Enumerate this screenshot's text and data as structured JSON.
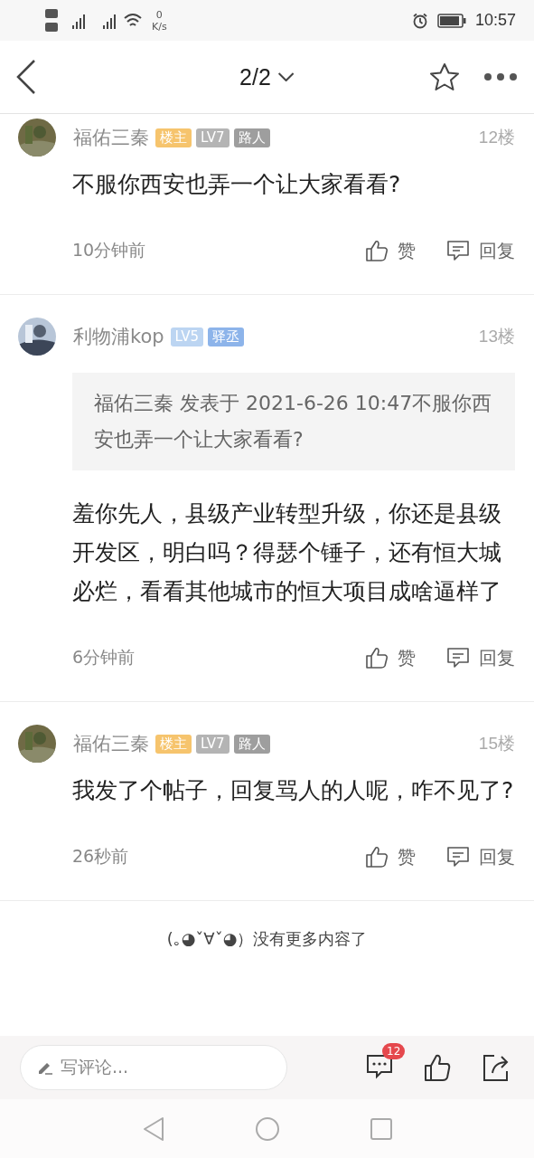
{
  "status_bar": {
    "speed_value": "0",
    "speed_unit": "K/s",
    "time": "10:57"
  },
  "header": {
    "page": "2/2"
  },
  "posts": [
    {
      "author": "福佑三秦",
      "badges": [
        {
          "text": "楼主",
          "color": "#f6c46d"
        },
        {
          "text": "LV7",
          "color": "#b4b4b4"
        },
        {
          "text": "路人",
          "color": "#9e9e9e"
        }
      ],
      "floor": "12楼",
      "body": "不服你西安也弄一个让大家看看?",
      "time": "10分钟前",
      "like": "赞",
      "reply": "回复"
    },
    {
      "author": "利物浦kop",
      "badges": [
        {
          "text": "LV5",
          "color": "#bcd5f2"
        },
        {
          "text": "驿丞",
          "color": "#8db4ea"
        }
      ],
      "floor": "13楼",
      "quote": "福佑三秦 发表于 2021-6-26 10:47不服你西安也弄一个让大家看看?",
      "body": "羞你先人，县级产业转型升级，你还是县级开发区，明白吗？得瑟个锤子，还有恒大城必烂，看看其他城市的恒大项目成啥逼样了",
      "time": "6分钟前",
      "like": "赞",
      "reply": "回复"
    },
    {
      "author": "福佑三秦",
      "badges": [
        {
          "text": "楼主",
          "color": "#f6c46d"
        },
        {
          "text": "LV7",
          "color": "#b4b4b4"
        },
        {
          "text": "路人",
          "color": "#9e9e9e"
        }
      ],
      "floor": "15楼",
      "body": "我发了个帖子，回复骂人的人呢，咋不见了?",
      "time": "26秒前",
      "like": "赞",
      "reply": "回复"
    }
  ],
  "end_note": "(｡◕ˇ∀ˇ◕）没有更多内容了",
  "comment_bar": {
    "placeholder": "写评论...",
    "comment_count": "12"
  }
}
